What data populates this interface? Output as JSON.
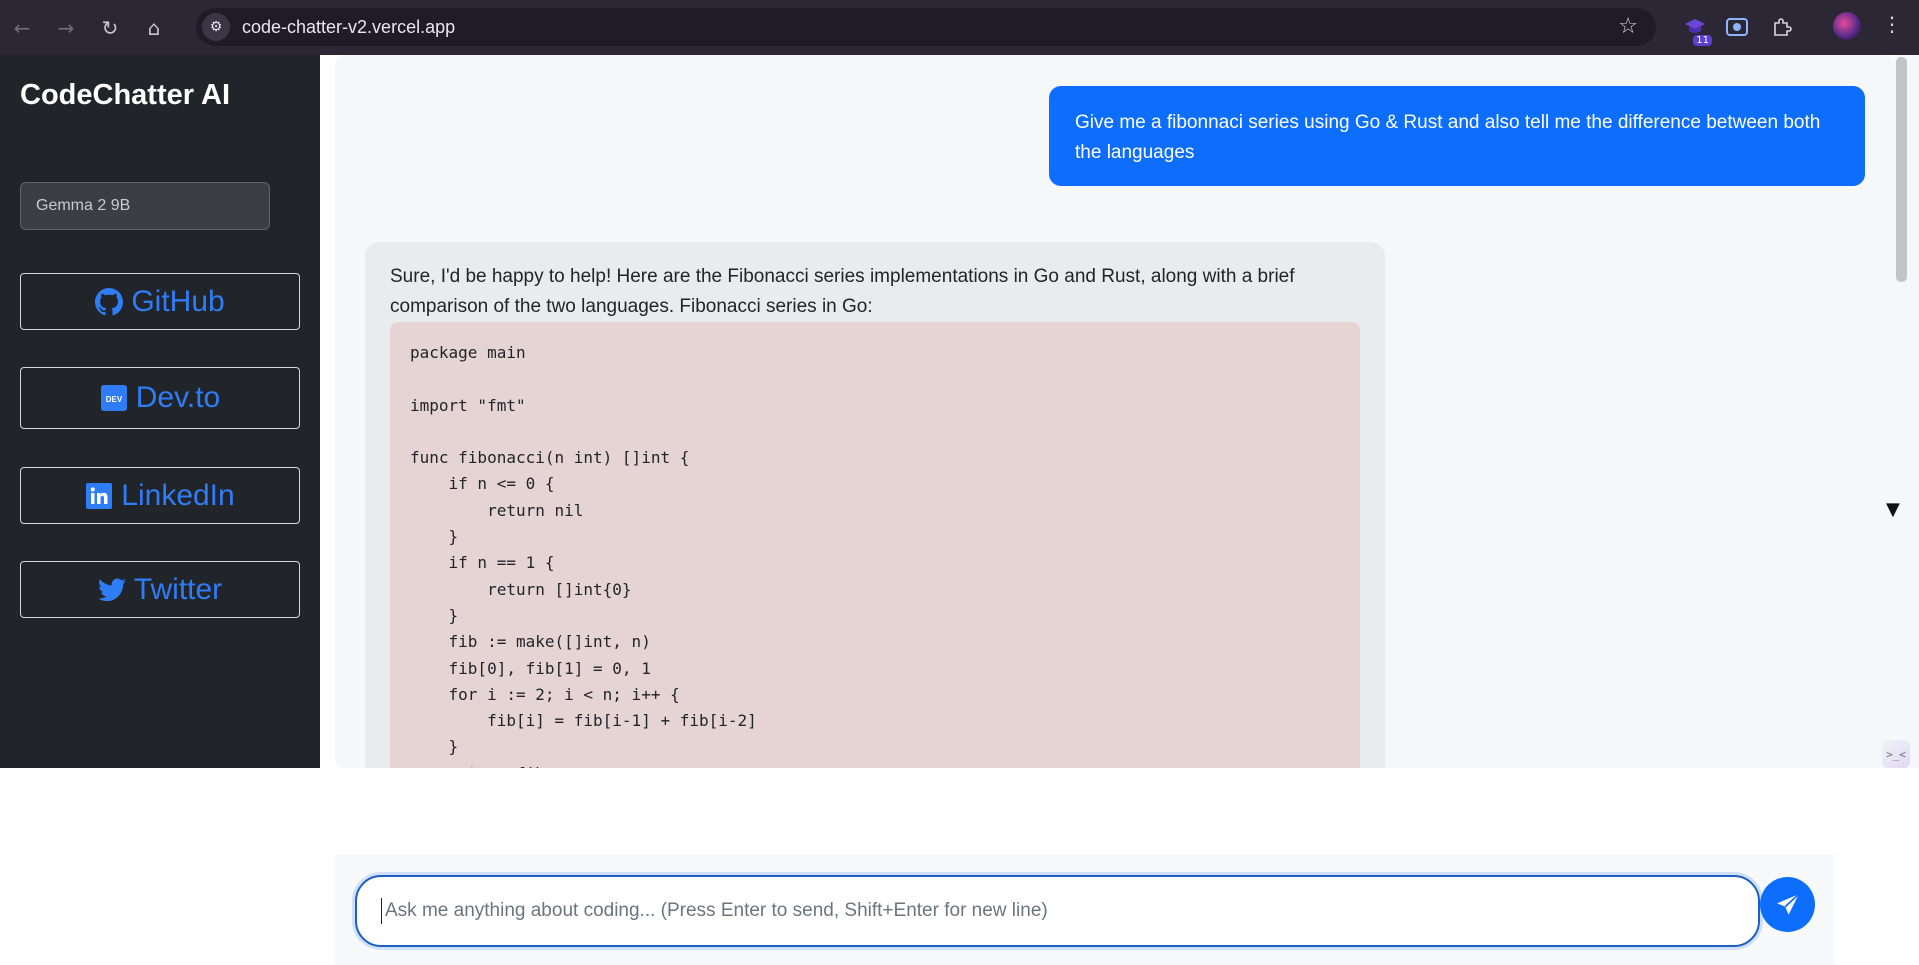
{
  "browser": {
    "back_icon": "←",
    "forward_icon": "→",
    "reload_icon": "↻",
    "home_icon": "⌂",
    "site_info_icon": "⚙",
    "url": "code-chatter-v2.vercel.app",
    "bookmark_icon": "☆",
    "extension_badge": "11",
    "menu_icon": "⋮"
  },
  "sidebar": {
    "title": "CodeChatter AI",
    "model_select": "Gemma 2 9B",
    "links": [
      {
        "label": "GitHub",
        "icon": "github-icon"
      },
      {
        "label": "Dev.to",
        "icon": "devto-icon"
      },
      {
        "label": "LinkedIn",
        "icon": "linkedin-icon"
      },
      {
        "label": "Twitter",
        "icon": "twitter-icon"
      }
    ]
  },
  "chat": {
    "user_message": "Give me a fibonnaci series using Go & Rust and also tell me the difference between both the languages",
    "bot_intro": "Sure, I'd be happy to help! Here are the Fibonacci series implementations in Go and Rust, along with a brief comparison of the two languages. Fibonacci series in Go:",
    "code": "package main\n\nimport \"fmt\"\n\nfunc fibonacci(n int) []int {\n    if n <= 0 {\n        return nil\n    }\n    if n == 1 {\n        return []int{0}\n    }\n    fib := make([]int, n)\n    fib[0], fib[1] = 0, 1\n    for i := 2; i < n; i++ {\n        fib[i] = fib[i-1] + fib[i-2]\n    }\n    return fib"
  },
  "input": {
    "placeholder": "Ask me anything about coding... (Press Enter to send, Shift+Enter for new line)"
  },
  "colors": {
    "accent": "#0d6efd",
    "sidebar_bg": "#212529",
    "link_color": "#2f7df6",
    "code_bg": "#e6d4d4"
  }
}
